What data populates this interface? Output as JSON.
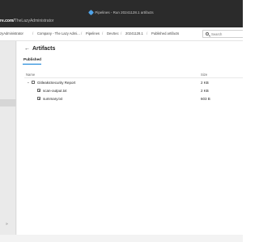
{
  "window": {
    "title": "Pipelines - Run 20241128.1 artifacts"
  },
  "browser": {
    "url_prefix": "re.com/",
    "url_rest": "TheLazyAdministrator"
  },
  "breadcrumb": {
    "items": [
      "zyAdministrator",
      "Company - The Lazy Admi...",
      "Pipelines",
      "DevSec",
      "20241128.1",
      "Published artifacts"
    ]
  },
  "search": {
    "placeholder": "Search"
  },
  "page": {
    "back_glyph": "←",
    "title": "Artifacts"
  },
  "tabs": [
    {
      "label": "Published"
    }
  ],
  "table": {
    "columns": [
      "Name",
      "Size"
    ],
    "rows": [
      {
        "name": "GitleaksSecurity Report",
        "size": "2 KB",
        "type": "folder",
        "expanded": true,
        "indent": 0
      },
      {
        "name": "scan-output.txt",
        "size": "2 KB",
        "type": "file",
        "indent": 1
      },
      {
        "name": "summary.txt",
        "size": "603 B",
        "type": "file",
        "indent": 1
      }
    ]
  },
  "sidebar": {
    "footer_glyph": "»"
  },
  "colors": {
    "accent": "#0078d4",
    "titlebar": "#2b2b2b"
  }
}
